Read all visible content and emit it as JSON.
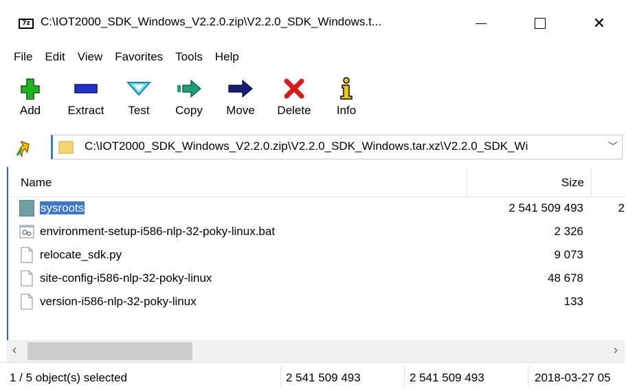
{
  "window": {
    "title": "C:\\IOT2000_SDK_Windows_V2.2.0.zip\\V2.2.0_SDK_Windows.t...",
    "app_icon_text": "7z"
  },
  "menu": [
    "File",
    "Edit",
    "View",
    "Favorites",
    "Tools",
    "Help"
  ],
  "toolbar": [
    {
      "label": "Add",
      "icon": "plus-icon",
      "color": "#1fb51f"
    },
    {
      "label": "Extract",
      "icon": "minus-icon",
      "color": "#2233cc"
    },
    {
      "label": "Test",
      "icon": "check-chevron-icon",
      "color": "#23b8d8"
    },
    {
      "label": "Copy",
      "icon": "copy-arrow-icon",
      "color": "#1c9e7a"
    },
    {
      "label": "Move",
      "icon": "move-arrow-icon",
      "color": "#14207a"
    },
    {
      "label": "Delete",
      "icon": "delete-x-icon",
      "color": "#e01818"
    },
    {
      "label": "Info",
      "icon": "info-icon",
      "color": "#c8a000"
    }
  ],
  "address": {
    "path": "C:\\IOT2000_SDK_Windows_V2.2.0.zip\\V2.2.0_SDK_Windows.tar.xz\\V2.2.0_SDK_Wi"
  },
  "columns": {
    "name": "Name",
    "size": "Size"
  },
  "files": [
    {
      "name": "sysroots",
      "size": "2 541 509 493",
      "type": "folder",
      "selected": true,
      "more": "2"
    },
    {
      "name": "environment-setup-i586-nlp-32-poky-linux.bat",
      "size": "2 326",
      "type": "bat"
    },
    {
      "name": "relocate_sdk.py",
      "size": "9 073",
      "type": "file"
    },
    {
      "name": "site-config-i586-nlp-32-poky-linux",
      "size": "48 678",
      "type": "file"
    },
    {
      "name": "version-i586-nlp-32-poky-linux",
      "size": "133",
      "type": "file"
    }
  ],
  "status": {
    "selection": "1 / 5 object(s) selected",
    "size": "2 541 509 493",
    "packed": "2 541 509 493",
    "modified": "2018-03-27 05"
  },
  "colors": {
    "accent": "#3b78d4",
    "selection": "#3b78d4",
    "folder": "#6e9fa6"
  }
}
